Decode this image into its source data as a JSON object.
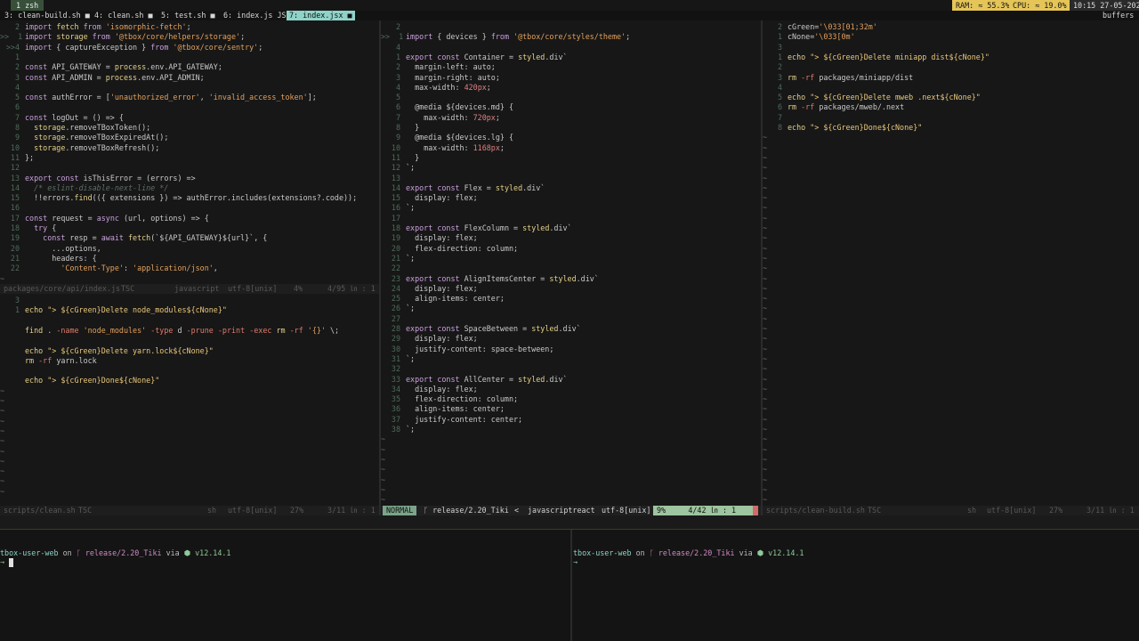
{
  "tmux": {
    "window_label": "1 zsh",
    "tabs": [
      {
        "label": "3: clean-build.sh ■",
        "active": false
      },
      {
        "label": "4: clean.sh ■",
        "active": false
      },
      {
        "label": "5: test.sh ■",
        "active": false
      },
      {
        "label": "6: index.js JS",
        "active": false
      },
      {
        "label": "7: index.jsx ■",
        "active": true
      }
    ],
    "ram": "RAM: ≈ 55.3%",
    "cpu": "CPU: ≈ 19.0%",
    "clock": "10:15  27-05-2020",
    "buffers": "buffers"
  },
  "pane_left_top": {
    "lines": [
      {
        "n": "2",
        "t": "import fetch from 'isomorphic-fetch';"
      },
      {
        "n": ">>  1",
        "t": "import storage from '@tbox/core/helpers/storage';"
      },
      {
        "n": ">>4",
        "t": "import { captureException } from '@tbox/core/sentry';"
      },
      {
        "n": "1",
        "t": ""
      },
      {
        "n": "2",
        "t": "const API_GATEWAY = process.env.API_GATEWAY;"
      },
      {
        "n": "3",
        "t": "const API_ADMIN = process.env.API_ADMIN;"
      },
      {
        "n": "4",
        "t": ""
      },
      {
        "n": "5",
        "t": "const authError = ['unauthorized_error', 'invalid_access_token'];"
      },
      {
        "n": "6",
        "t": ""
      },
      {
        "n": "7",
        "t": "const logOut = () => {"
      },
      {
        "n": "8",
        "t": "  storage.removeTBoxToken();"
      },
      {
        "n": "9",
        "t": "  storage.removeTBoxExpiredAt();"
      },
      {
        "n": "10",
        "t": "  storage.removeTBoxRefresh();"
      },
      {
        "n": "11",
        "t": "};"
      },
      {
        "n": "12",
        "t": ""
      },
      {
        "n": "13",
        "t": "export const isThisError = (errors) =>"
      },
      {
        "n": "14",
        "t": "  /* eslint-disable-next-line */"
      },
      {
        "n": "15",
        "t": "  !!errors.find(({ extensions }) => authError.includes(extensions?.code));"
      },
      {
        "n": "16",
        "t": ""
      },
      {
        "n": "17",
        "t": "const request = async (url, options) => {"
      },
      {
        "n": "18",
        "t": "  try {"
      },
      {
        "n": "19",
        "t": "    const resp = await fetch(`${API_GATEWAY}${url}`, {"
      },
      {
        "n": "20",
        "t": "      ...options,"
      },
      {
        "n": "21",
        "t": "      headers: {"
      },
      {
        "n": "22",
        "t": "        'Content-Type': 'application/json',"
      }
    ],
    "status": {
      "file": "packages/core/api/index.js",
      "ft": "TSC",
      "lang": "javascript",
      "enc": "utf-8[unix]",
      "pct": "4%",
      "pos": "4/95 ㏑ :  1"
    }
  },
  "pane_left_bottom": {
    "lines": [
      {
        "n": "3",
        "t": ""
      },
      {
        "n": "1",
        "t": "echo \"> ${cGreen}Delete node_modules${cNone}\""
      },
      {
        "n": "",
        "t": ""
      },
      {
        "n": "",
        "t": "find . -name 'node_modules' -type d -prune -print -exec rm -rf '{}' \\;"
      },
      {
        "n": "",
        "t": ""
      },
      {
        "n": "",
        "t": "echo \"> ${cGreen}Delete yarn.lock${cNone}\""
      },
      {
        "n": "",
        "t": "rm -rf yarn.lock"
      },
      {
        "n": "",
        "t": ""
      },
      {
        "n": "",
        "t": "echo \"> ${cGreen}Done${cNone}\""
      }
    ],
    "status": {
      "file": "scripts/clean.sh",
      "ft": "TSC",
      "lang": "sh",
      "enc": "utf-8[unix]",
      "pct": "27%",
      "pos": "3/11 ㏑ :  1"
    }
  },
  "pane_middle": {
    "lines": [
      {
        "n": "2",
        "t": ""
      },
      {
        "n": ">>  1",
        "t": "import { devices } from '@tbox/core/styles/theme';"
      },
      {
        "n": "4",
        "t": ""
      },
      {
        "n": "1",
        "t": "export const Container = styled.div`"
      },
      {
        "n": "2",
        "t": "  margin-left: auto;"
      },
      {
        "n": "3",
        "t": "  margin-right: auto;"
      },
      {
        "n": "4",
        "t": "  max-width: 420px;"
      },
      {
        "n": "5",
        "t": ""
      },
      {
        "n": "6",
        "t": "  @media ${devices.md} {"
      },
      {
        "n": "7",
        "t": "    max-width: 720px;"
      },
      {
        "n": "8",
        "t": "  }"
      },
      {
        "n": "9",
        "t": "  @media ${devices.lg} {"
      },
      {
        "n": "10",
        "t": "    max-width: 1168px;"
      },
      {
        "n": "11",
        "t": "  }"
      },
      {
        "n": "12",
        "t": "`;"
      },
      {
        "n": "13",
        "t": ""
      },
      {
        "n": "14",
        "t": "export const Flex = styled.div`"
      },
      {
        "n": "15",
        "t": "  display: flex;"
      },
      {
        "n": "16",
        "t": "`;"
      },
      {
        "n": "17",
        "t": ""
      },
      {
        "n": "18",
        "t": "export const FlexColumn = styled.div`"
      },
      {
        "n": "19",
        "t": "  display: flex;"
      },
      {
        "n": "20",
        "t": "  flex-direction: column;"
      },
      {
        "n": "21",
        "t": "`;"
      },
      {
        "n": "22",
        "t": ""
      },
      {
        "n": "23",
        "t": "export const AlignItemsCenter = styled.div`"
      },
      {
        "n": "24",
        "t": "  display: flex;"
      },
      {
        "n": "25",
        "t": "  align-items: center;"
      },
      {
        "n": "26",
        "t": "`;"
      },
      {
        "n": "27",
        "t": ""
      },
      {
        "n": "28",
        "t": "export const SpaceBetween = styled.div`"
      },
      {
        "n": "29",
        "t": "  display: flex;"
      },
      {
        "n": "30",
        "t": "  justify-content: space-between;"
      },
      {
        "n": "31",
        "t": "`;"
      },
      {
        "n": "32",
        "t": ""
      },
      {
        "n": "33",
        "t": "export const AllCenter = styled.div`"
      },
      {
        "n": "34",
        "t": "  display: flex;"
      },
      {
        "n": "35",
        "t": "  flex-direction: column;"
      },
      {
        "n": "36",
        "t": "  align-items: center;"
      },
      {
        "n": "37",
        "t": "  justify-content: center;"
      },
      {
        "n": "38",
        "t": "`;"
      }
    ],
    "status": {
      "mode": "NORMAL",
      "branch": "ᚴ release/2.20_Tiki",
      "arrow": "<",
      "lang": "javascriptreact",
      "enc": "utf-8[unix]",
      "pct": "9%",
      "pos": "4/42 ㏑ :  1"
    }
  },
  "pane_right": {
    "lines": [
      {
        "n": "2",
        "t": "cGreen='\\033[01;32m'"
      },
      {
        "n": "1",
        "t": "cNone='\\033[0m'"
      },
      {
        "n": "3",
        "t": ""
      },
      {
        "n": "1",
        "t": "echo \"> ${cGreen}Delete miniapp dist${cNone}\""
      },
      {
        "n": "2",
        "t": ""
      },
      {
        "n": "3",
        "t": "rm -rf packages/miniapp/dist"
      },
      {
        "n": "4",
        "t": ""
      },
      {
        "n": "5",
        "t": "echo \"> ${cGreen}Delete mweb .next${cNone}\""
      },
      {
        "n": "6",
        "t": "rm -rf packages/mweb/.next"
      },
      {
        "n": "7",
        "t": ""
      },
      {
        "n": "8",
        "t": "echo \"> ${cGreen}Done${cNone}\""
      }
    ],
    "status": {
      "file": "scripts/clean-build.sh",
      "ft": "TSC",
      "lang": "sh",
      "enc": "utf-8[unix]",
      "pct": "27%",
      "pos": "3/11 ㏑ :  1"
    }
  },
  "shell_left": {
    "dir": "tbox-user-web",
    "on": "on",
    "branch": "ᚴ release/2.20_Tiki",
    "via": "via",
    "node": "⬢ v12.14.1",
    "arrow": "→"
  },
  "shell_right": {
    "dir": "tbox-user-web",
    "on": "on",
    "branch": "ᚴ release/2.20_Tiki",
    "via": "via",
    "node": "⬢ v12.14.1",
    "arrow": "→"
  }
}
